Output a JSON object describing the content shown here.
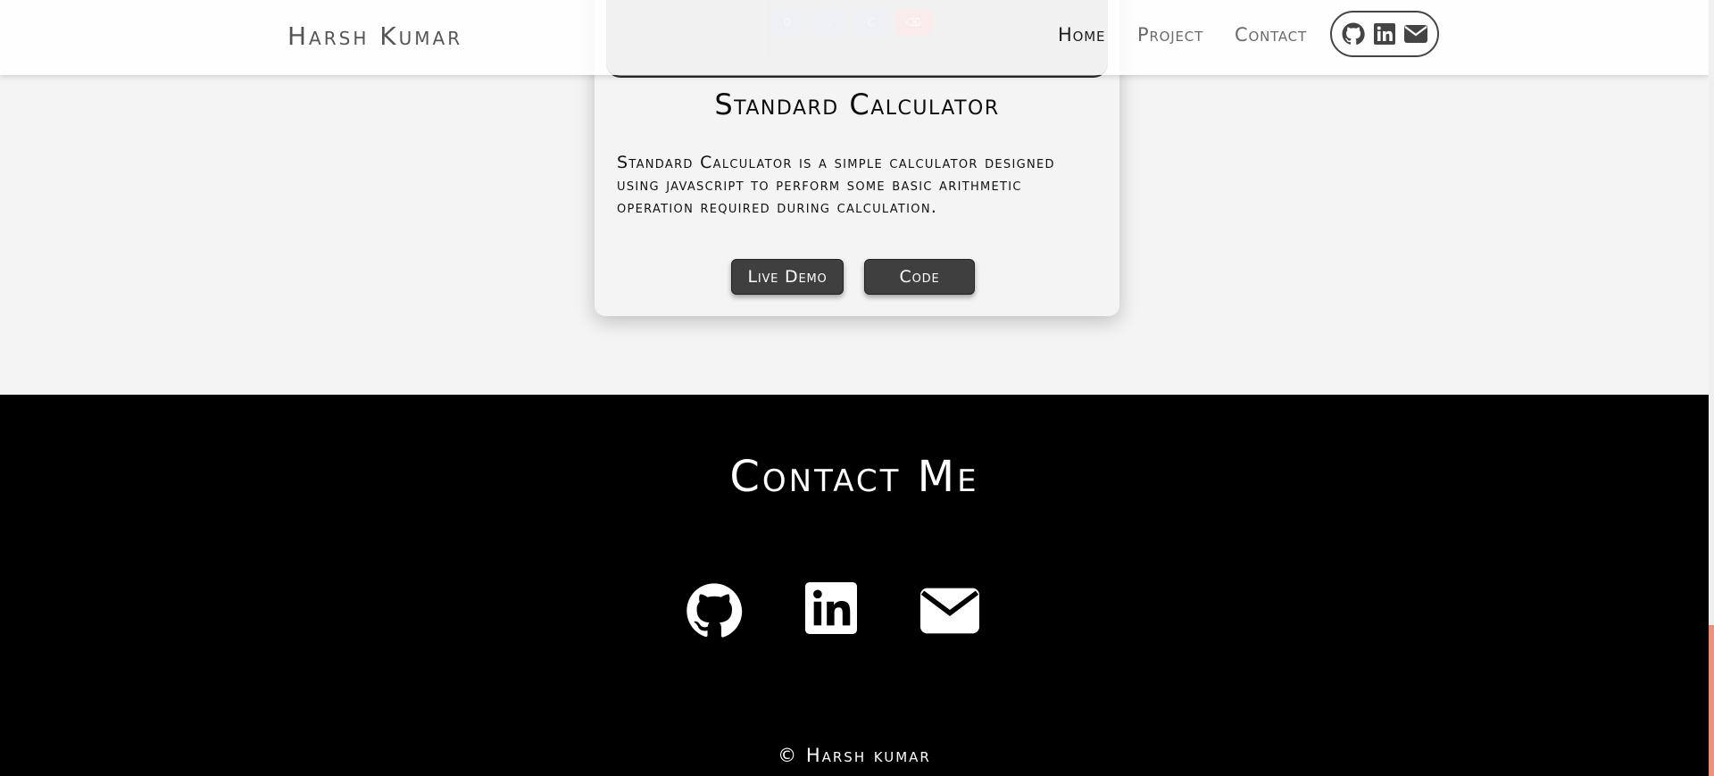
{
  "navbar": {
    "brand": "Harsh Kumar",
    "links": [
      "Home",
      "Project",
      "Contact"
    ],
    "icons": [
      "github-icon",
      "linkedin-icon",
      "envelope-icon"
    ]
  },
  "project": {
    "preview_keys": [
      "0",
      ".",
      "C",
      "⌫"
    ],
    "title": "Standard Calculator",
    "description": "Standard Calculator is a simple calculator designed using javascript to perform some basic arithmetic operation required during calculation.",
    "live_demo_label": "Live Demo",
    "code_label": "Code"
  },
  "footer": {
    "title": "Contact Me",
    "socials": [
      "github-icon",
      "linkedin-icon",
      "envelope-icon"
    ],
    "copyright": "© Harsh kumar"
  },
  "colors": {
    "navbar_bg": "#ffffff",
    "page_bg": "#f4f4f4",
    "footer_bg": "#000000",
    "button_bg": "#3f3f3f",
    "preview_bg": "#a39ea4",
    "danger_key": "#de7b82",
    "scrollbar_thumb": "#ee8f7c"
  }
}
